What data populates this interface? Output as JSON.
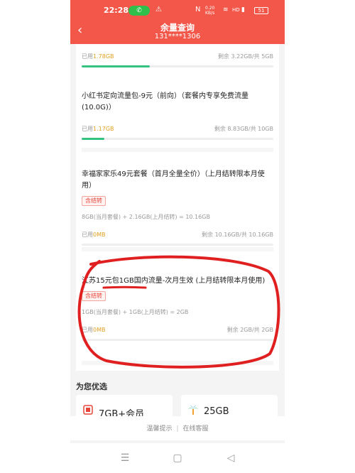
{
  "status_bar": {
    "time": "22:28",
    "call_icon": "phone-icon",
    "left_icons": [
      "warning-icon"
    ],
    "right_icons": [
      "nfc-icon",
      "data-speed-icon",
      "wifi-icon",
      "signal-icon"
    ],
    "data_speed": "0.20 KB/s",
    "hd": "HD",
    "battery": "51"
  },
  "header": {
    "title": "余量查询",
    "subtitle": "131****1306"
  },
  "packages": [
    {
      "title": "",
      "tag": "",
      "calc": "",
      "used_label": "已用",
      "used_value": "1.78GB",
      "remain_text": "剩余 3.22GB/共 5GB",
      "fill": 0.356
    },
    {
      "title": "小红书定向流量包-9元（前向）（套餐内专享免费流量(10.0G)）",
      "tag": "",
      "calc": "",
      "used_label": "已用",
      "used_value": "1.17GB",
      "remain_text": "剩余 8.83GB/共 10GB",
      "fill": 0.117
    },
    {
      "title": "幸福家家乐49元套餐（首月全量全价）（上月结转限本月使用）",
      "tag": "含结转",
      "calc": "8GB(当月套餐) + 2.16GB(上月结转) = 10.16GB",
      "used_label": "已用",
      "used_value": "0MB",
      "remain_text": "剩余 10.16GB/共 10.16GB",
      "fill": 0.0
    },
    {
      "title": "江苏15元包1GB国内流量-次月生效 (上月结转限本月使用)",
      "tag": "含结转",
      "calc": "1GB(当月套餐) + 1GB(上月结转) = 2GB",
      "used_label": "已用",
      "used_value": "0MB",
      "remain_text": "剩余 2GB/共 2GB",
      "fill": 0.0
    }
  ],
  "recommend": {
    "title": "为您优选",
    "items": [
      {
        "label": "7GB+会员",
        "icon": "gift-icon"
      },
      {
        "label": "25GB",
        "icon": "palm-tree-icon"
      }
    ]
  },
  "footer": {
    "tip": "温馨提示",
    "service": "在线客服",
    "separator": "|"
  },
  "nav": {
    "menu": "☰",
    "home": "▢",
    "back": "◁"
  },
  "colors": {
    "header": "#f2574a",
    "accent": "#e8453a",
    "bar_green": "#35c27f",
    "used_value": "#e0a020"
  }
}
